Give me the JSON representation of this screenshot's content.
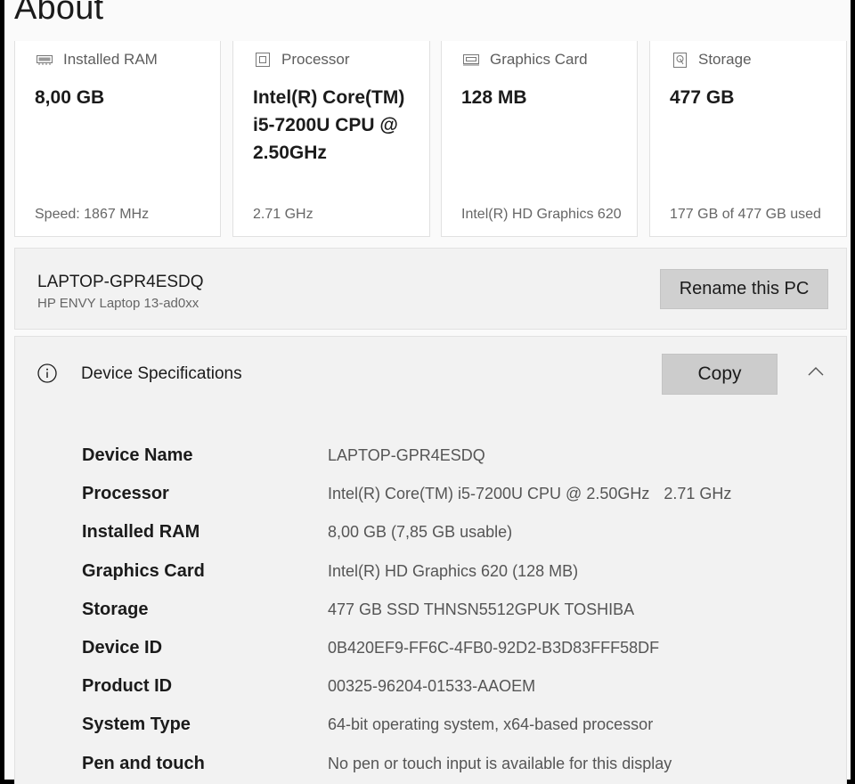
{
  "page": {
    "title": "About"
  },
  "cards": [
    {
      "icon": "ram-icon",
      "label": "Installed RAM",
      "value": "8,00 GB",
      "sub": "Speed: 1867 MHz"
    },
    {
      "icon": "processor-icon",
      "label": "Processor",
      "value": "Intel(R) Core(TM) i5-7200U CPU @ 2.50GHz",
      "sub": "2.71 GHz"
    },
    {
      "icon": "graphics-card-icon",
      "label": "Graphics Card",
      "value": "128 MB",
      "sub": "Intel(R) HD Graphics 620"
    },
    {
      "icon": "storage-icon",
      "label": "Storage",
      "value": "477 GB",
      "sub": "177 GB of 477 GB used"
    }
  ],
  "pc": {
    "name": "LAPTOP-GPR4ESDQ",
    "model": "HP ENVY Laptop 13-ad0xx",
    "rename_label": "Rename this PC"
  },
  "specs": {
    "title": "Device Specifications",
    "copy_label": "Copy",
    "rows": [
      {
        "label": "Device Name",
        "value": "LAPTOP-GPR4ESDQ",
        "extra": ""
      },
      {
        "label": "Processor",
        "value": "Intel(R) Core(TM) i5-7200U CPU @ 2.50GHz",
        "extra": "2.71 GHz"
      },
      {
        "label": "Installed RAM",
        "value": "8,00 GB (7,85 GB usable)",
        "extra": ""
      },
      {
        "label": "Graphics Card",
        "value": "Intel(R) HD Graphics 620 (128 MB)",
        "extra": ""
      },
      {
        "label": "Storage",
        "value": "477 GB SSD THNSN5512GPUK TOSHIBA",
        "extra": ""
      },
      {
        "label": "Device ID",
        "value": "0B420EF9-FF6C-4FB0-92D2-B3D83FFF58DF",
        "extra": ""
      },
      {
        "label": "Product ID",
        "value": "00325-96204-01533-AAOEM",
        "extra": ""
      },
      {
        "label": "System Type",
        "value": "64-bit operating system, x64-based processor",
        "extra": ""
      },
      {
        "label": "Pen and touch",
        "value": "No pen or touch input is available for this display",
        "extra": ""
      }
    ]
  }
}
